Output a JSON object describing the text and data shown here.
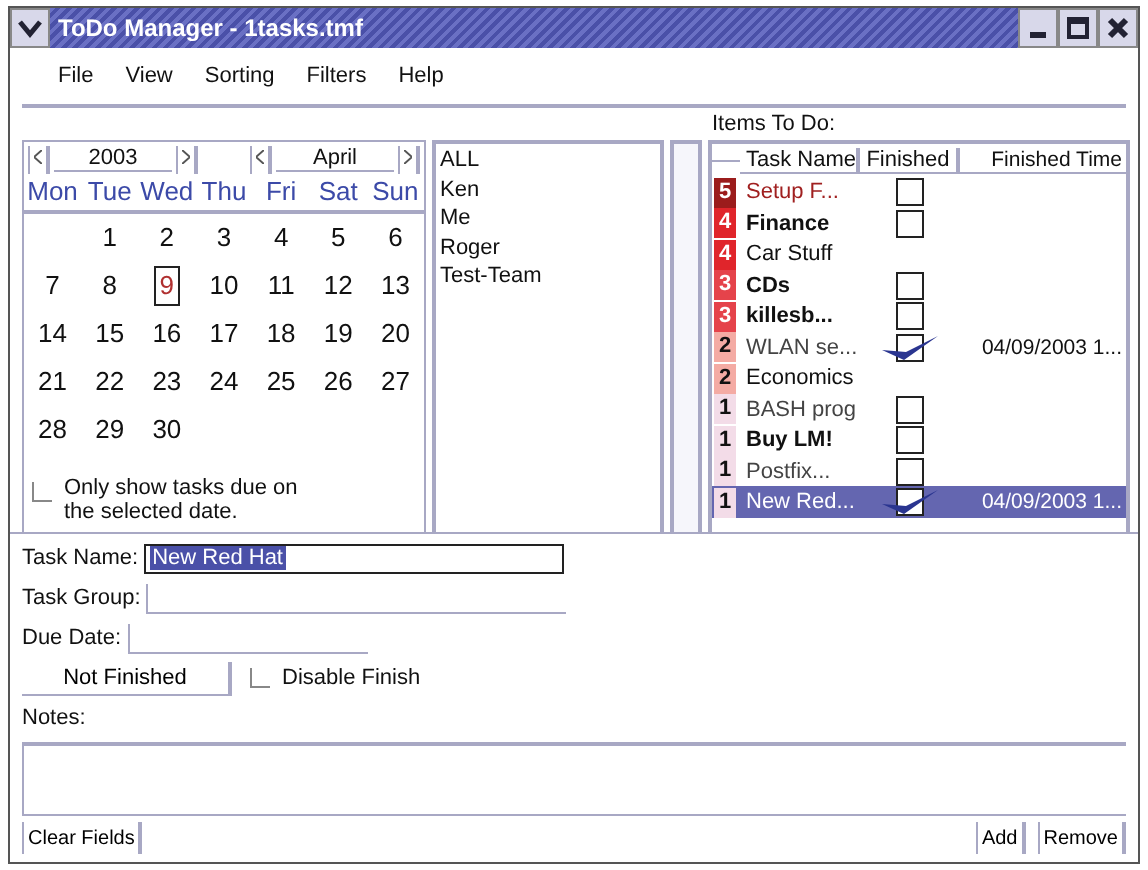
{
  "window": {
    "title": "ToDo Manager - 1tasks.tmf"
  },
  "menu": [
    "File",
    "View",
    "Sorting",
    "Filters",
    "Help"
  ],
  "calendar": {
    "year": "2003",
    "month": "April",
    "weekdays": [
      "Mon",
      "Tue",
      "Wed",
      "Thu",
      "Fri",
      "Sat",
      "Sun"
    ],
    "weeks": [
      [
        {
          "day": "1",
          "selected": false
        },
        {
          "day": "2",
          "selected": false
        },
        {
          "day": "3",
          "selected": false
        },
        {
          "day": "4",
          "selected": false
        },
        {
          "day": "5",
          "selected": false
        },
        {
          "day": "6",
          "selected": false
        }
      ],
      [
        {
          "day": "7",
          "selected": false
        },
        {
          "day": "8",
          "selected": false
        },
        {
          "day": "9",
          "selected": true
        },
        {
          "day": "10",
          "selected": false
        },
        {
          "day": "11",
          "selected": false
        },
        {
          "day": "12",
          "selected": false
        },
        {
          "day": "13",
          "selected": false
        }
      ],
      [
        {
          "day": "14",
          "selected": false
        },
        {
          "day": "15",
          "selected": false
        },
        {
          "day": "16",
          "selected": false
        },
        {
          "day": "17",
          "selected": false
        },
        {
          "day": "18",
          "selected": false
        },
        {
          "day": "19",
          "selected": false
        },
        {
          "day": "20",
          "selected": false
        }
      ],
      [
        {
          "day": "21",
          "selected": false
        },
        {
          "day": "22",
          "selected": false
        },
        {
          "day": "23",
          "selected": false
        },
        {
          "day": "24",
          "selected": false
        },
        {
          "day": "25",
          "selected": false
        },
        {
          "day": "26",
          "selected": false
        },
        {
          "day": "27",
          "selected": false
        }
      ],
      [
        {
          "day": "28",
          "selected": false
        },
        {
          "day": "29",
          "selected": false
        },
        {
          "day": "30",
          "selected": false
        }
      ]
    ],
    "filter_option": {
      "label": "Only show tasks due on the selected date.",
      "checked": false
    }
  },
  "groups": [
    "ALL",
    "Ken",
    "Me",
    "Roger",
    "Test-Team"
  ],
  "tasks": {
    "title": "Items To Do:",
    "columns": [
      "Task Name",
      "Finished",
      "Finished Time"
    ],
    "rows": [
      {
        "priority": "5",
        "color": "#9b1c1c",
        "name": "Setup F...",
        "highlighted": true,
        "bold": false,
        "dimmed": false,
        "kind": "checkbox",
        "checked": false,
        "selected": false
      },
      {
        "priority": "4",
        "color": "#e0252b",
        "name": "Finance",
        "highlighted": false,
        "bold": true,
        "dimmed": false,
        "kind": "checkbox",
        "checked": false,
        "selected": false
      },
      {
        "priority": "4",
        "color": "#e0252b",
        "name": "Car Stuff",
        "highlighted": false,
        "bold": false,
        "dimmed": false,
        "kind": "plain",
        "selected": false
      },
      {
        "priority": "3",
        "color": "#e5434b",
        "name": "CDs",
        "highlighted": false,
        "bold": true,
        "dimmed": false,
        "kind": "checkbox",
        "checked": false,
        "selected": false
      },
      {
        "priority": "3",
        "color": "#e5434b",
        "name": "killesb...",
        "highlighted": false,
        "bold": true,
        "dimmed": false,
        "kind": "checkbox",
        "checked": false,
        "selected": false
      },
      {
        "priority": "2",
        "color": "#f4aba4",
        "name": "WLAN se...",
        "highlighted": false,
        "bold": false,
        "dimmed": true,
        "kind": "checkbox",
        "checked": true,
        "finished_time": "04/09/2003 1...",
        "selected": false
      },
      {
        "priority": "2",
        "color": "#f4aba4",
        "name": "Economics",
        "highlighted": false,
        "bold": false,
        "dimmed": false,
        "kind": "plain",
        "selected": false
      },
      {
        "priority": "1",
        "color": "#f3dce8",
        "name": "BASH prog",
        "highlighted": false,
        "bold": false,
        "dimmed": true,
        "kind": "checkbox",
        "checked": false,
        "selected": false
      },
      {
        "priority": "1",
        "color": "#f3dce8",
        "name": "Buy LM!",
        "highlighted": false,
        "bold": true,
        "dimmed": false,
        "kind": "checkbox",
        "checked": false,
        "selected": false
      },
      {
        "priority": "1",
        "color": "#f3dce8",
        "name": "Postfix...",
        "highlighted": false,
        "bold": false,
        "dimmed": true,
        "kind": "checkbox",
        "checked": false,
        "selected": false
      },
      {
        "priority": "1",
        "color": "#f3dce8",
        "name": "New Red...",
        "highlighted": false,
        "bold": false,
        "dimmed": false,
        "kind": "checkbox",
        "checked": true,
        "finished_time": "04/09/2003 1...",
        "selected": true
      }
    ]
  },
  "form": {
    "task_name": {
      "label": "Task Name:",
      "value": "New Red Hat"
    },
    "task_group": {
      "label": "Task Group:"
    },
    "due_date": {
      "label": "Due Date:"
    },
    "status_button": "Not Finished",
    "disable_finish": {
      "label": "Disable Finish",
      "checked": false
    },
    "notes": {
      "label": "Notes:"
    },
    "buttons": {
      "clear": "Clear Fields",
      "add": "Add",
      "remove": "Remove"
    }
  }
}
